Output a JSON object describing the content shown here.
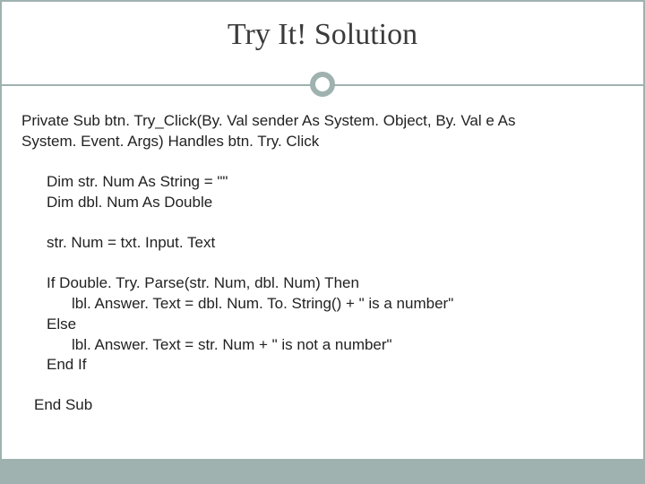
{
  "title": "Try It! Solution",
  "code": {
    "sig1": "Private Sub btn. Try_Click(By. Val sender As System. Object, By. Val e As",
    "sig2": "System. Event. Args) Handles btn. Try. Click",
    "dim1": "Dim str. Num As String = \"\"",
    "dim2": "Dim dbl. Num As Double",
    "assign": "str. Num = txt. Input. Text",
    "if_line": "If Double. Try. Parse(str. Num, dbl. Num) Then",
    "then_line": "lbl. Answer. Text = dbl. Num. To. String() + \" is a number\"",
    "else_line": "Else",
    "else_body": "lbl. Answer. Text = str. Num + \" is not a number\"",
    "endif": "End If",
    "endsub": "End Sub"
  }
}
